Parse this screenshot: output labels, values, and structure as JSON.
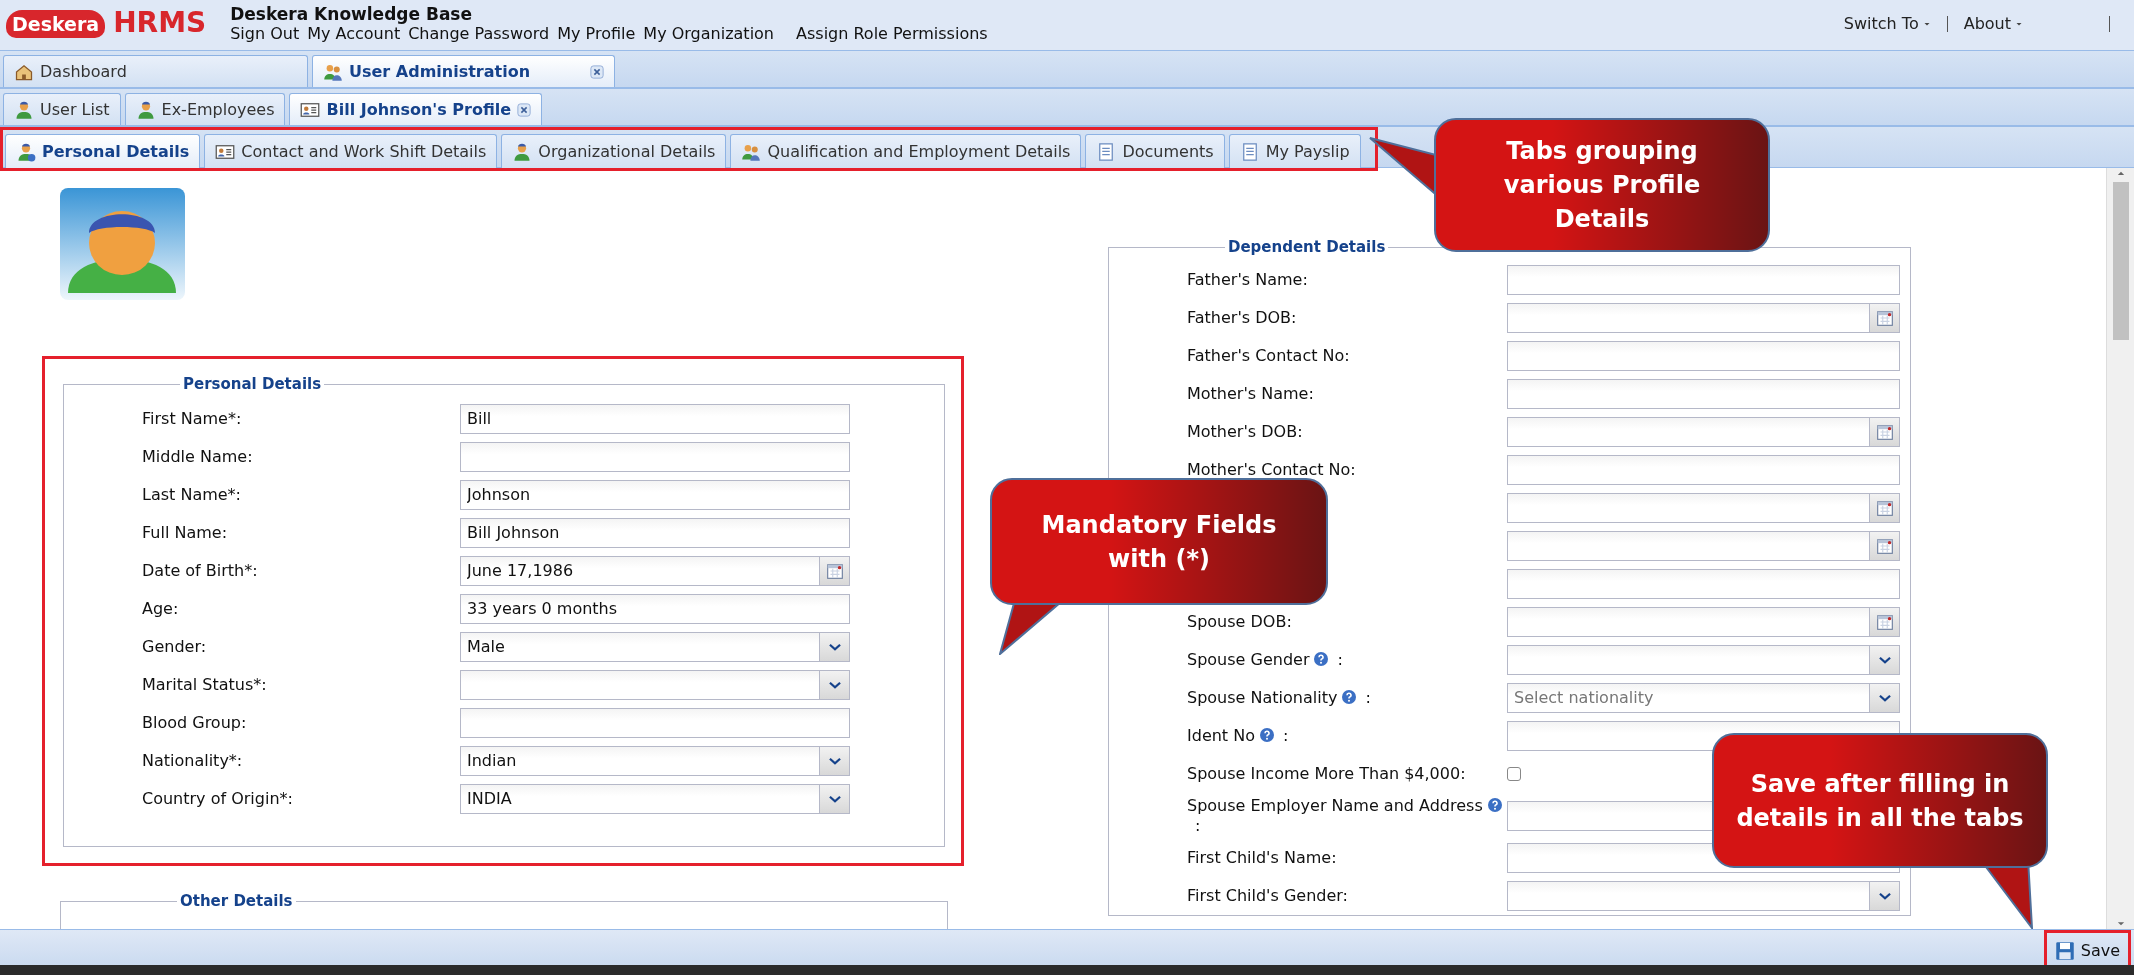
{
  "header": {
    "logo_brand": "Deskera",
    "logo_product": "HRMS",
    "site_title": "Deskera Knowledge Base",
    "links": [
      "Sign Out",
      "My Account",
      "Change Password",
      "My Profile",
      "My Organization",
      "Assign Role Permissions"
    ],
    "menus": [
      "Switch To",
      "About"
    ]
  },
  "main_tabs": [
    {
      "label": "Dashboard",
      "selected": false,
      "closable": false
    },
    {
      "label": "User Administration",
      "selected": true,
      "closable": true
    }
  ],
  "sub_tabs": [
    {
      "label": "User List",
      "selected": false,
      "closable": false
    },
    {
      "label": "Ex-Employees",
      "selected": false,
      "closable": false
    },
    {
      "label": "Bill Johnson's Profile",
      "selected": true,
      "closable": true
    }
  ],
  "profile_tabs": [
    {
      "label": "Personal Details",
      "selected": true
    },
    {
      "label": "Contact and Work Shift Details",
      "selected": false
    },
    {
      "label": "Organizational Details",
      "selected": false
    },
    {
      "label": "Qualification and Employment Details",
      "selected": false
    },
    {
      "label": "Documents",
      "selected": false
    },
    {
      "label": "My Payslip",
      "selected": false
    }
  ],
  "personal_details": {
    "legend": "Personal Details",
    "fields": [
      {
        "label": "First Name*:",
        "kind": "text",
        "value": "Bill"
      },
      {
        "label": "Middle Name:",
        "kind": "text"
      },
      {
        "label": "Last Name*:",
        "kind": "text",
        "value": "Johnson"
      },
      {
        "label": "Full Name:",
        "kind": "text",
        "value": "Bill Johnson"
      },
      {
        "label": "Date of Birth*:",
        "kind": "date",
        "value": "June 17,1986"
      },
      {
        "label": "Age:",
        "kind": "text",
        "value": "33 years 0 months"
      },
      {
        "label": "Gender:",
        "kind": "select",
        "value": "Male"
      },
      {
        "label": "Marital Status*:",
        "kind": "select"
      },
      {
        "label": "Blood Group:",
        "kind": "text"
      },
      {
        "label": "Nationality*:",
        "kind": "select",
        "value": "Indian"
      },
      {
        "label": "Country of Origin*:",
        "kind": "select",
        "value": "INDIA"
      }
    ]
  },
  "other_details": {
    "legend": "Other Details"
  },
  "dependent_details": {
    "legend": "Dependent Details",
    "fields": [
      {
        "label": "Father's Name:",
        "kind": "text"
      },
      {
        "label": "Father's DOB:",
        "kind": "date"
      },
      {
        "label": "Father's Contact No:",
        "kind": "text"
      },
      {
        "label": "Mother's Name:",
        "kind": "text"
      },
      {
        "label": "Mother's DOB:",
        "kind": "date"
      },
      {
        "label": "Mother's Contact No:",
        "kind": "text"
      },
      {
        "kind": "date"
      },
      {
        "kind": "date"
      },
      {
        "kind": "text"
      },
      {
        "label": "Spouse DOB:",
        "kind": "date"
      },
      {
        "label": "Spouse Gender",
        "help": true,
        "suffix": ":",
        "kind": "select"
      },
      {
        "label": "Spouse Nationality",
        "help": true,
        "suffix": ":",
        "kind": "select",
        "placeholder": "Select nationality"
      },
      {
        "label": "Ident No",
        "help": true,
        "suffix": ":",
        "kind": "text"
      },
      {
        "label": "Spouse Income More Than $4,000:",
        "kind": "checkbox",
        "checked": false
      },
      {
        "label": "Spouse Employer Name and Address",
        "help": true,
        "suffix": ":",
        "kind": "text"
      },
      {
        "label": "First Child's Name:",
        "kind": "text"
      },
      {
        "label": "First Child's Gender:",
        "kind": "select"
      }
    ]
  },
  "callouts": [
    {
      "text": "Tabs grouping various Profile Details",
      "kind": "left"
    },
    {
      "text": "Mandatory Fields with (*)",
      "kind": "down-left"
    },
    {
      "text": "Save after filling in details in all the tabs",
      "kind": "down-right"
    }
  ],
  "save_button": {
    "label": "Save"
  }
}
